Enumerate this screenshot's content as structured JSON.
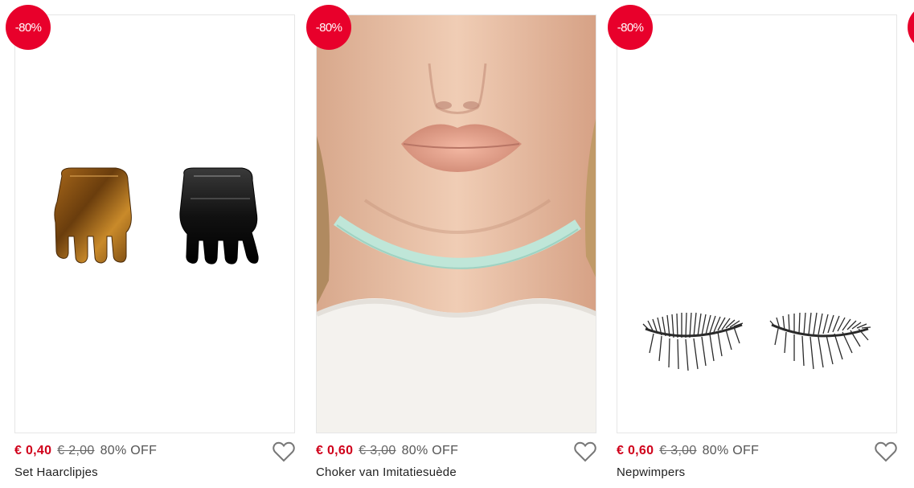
{
  "products": [
    {
      "badge": "-80%",
      "price_now": "€ 0,40",
      "price_old": "€ 2,00",
      "discount": "80% OFF",
      "name": "Set Haarclipjes",
      "image": "hair-clips-image"
    },
    {
      "badge": "-80%",
      "price_now": "€ 0,60",
      "price_old": "€ 3,00",
      "discount": "80% OFF",
      "name": "Choker van Imitatiesuède",
      "image": "choker-model-image"
    },
    {
      "badge": "-80%",
      "price_now": "€ 0,60",
      "price_old": "€ 3,00",
      "discount": "80% OFF",
      "name": "Nepwimpers",
      "image": "false-eyelashes-image"
    }
  ],
  "colors": {
    "badge": "#e8002b",
    "price_now": "#d0021b",
    "price_old": "#666666",
    "border": "#e6e6e6"
  },
  "icons": {
    "wishlist": "heart-icon"
  }
}
